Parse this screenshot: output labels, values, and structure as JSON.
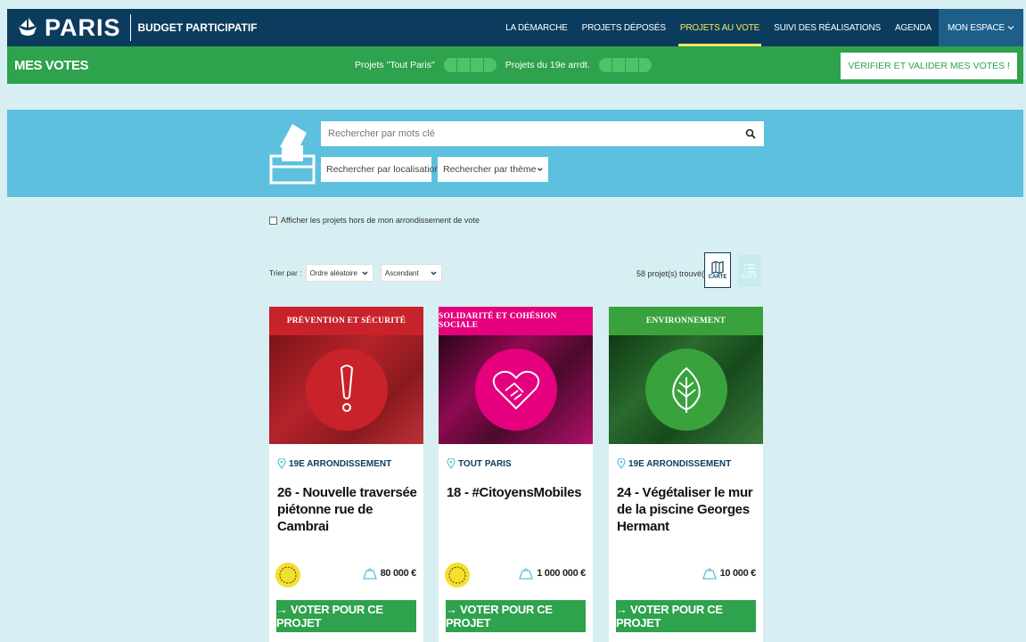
{
  "header": {
    "logo_text": "PARIS",
    "subtitle": "BUDGET PARTICIPATIF",
    "nav": [
      {
        "label": "LA DÉMARCHE"
      },
      {
        "label": "PROJETS DÉPOSÉS"
      },
      {
        "label": "PROJETS AU VOTE",
        "active": true
      },
      {
        "label": "SUIVI DES RÉALISATIONS"
      },
      {
        "label": "AGENDA"
      }
    ],
    "account_label": "MON ESPACE"
  },
  "votebar": {
    "title": "MES VOTES",
    "counter_paris": "Projets \"Tout Paris\"",
    "counter_arrdt": "Projets du 19e arrdt.",
    "validate_label": "VÉRIFIER ET VALIDER MES VOTES !"
  },
  "search": {
    "placeholder": "Rechercher par mots clé",
    "location_label": "Rechercher par localisation",
    "theme_label": "Rechercher par thème"
  },
  "filters": {
    "outside_label": "Afficher les projets hors de mon arrondissement de vote",
    "sort_label": "Trier par :",
    "sort_value": "Ordre aléatoire",
    "order_value": "Ascendant",
    "found": "58 projet(s) trouvé(s)",
    "view_map": "CARTE",
    "view_list": "LISTE"
  },
  "colors": {
    "navy": "#0b3c5d",
    "green": "#2ea24c",
    "cyan": "#5cc0de",
    "red": "#c8222a",
    "magenta": "#e5007e",
    "leaf_green": "#3aa23c"
  },
  "cards": [
    {
      "theme": "PRÉVENTION ET SÉCURITÉ",
      "icon": "exclamation-icon",
      "location": "19E ARRONDISSEMENT",
      "title": "26 - Nouvelle traversée piétonne rue de Cambrai",
      "budget": "80 000 €",
      "vote_label": "→ VOTER POUR CE PROJET"
    },
    {
      "theme": "SOLIDARITÉ ET COHÉSION SOCIALE",
      "icon": "heart-handshake-icon",
      "location": "TOUT PARIS",
      "title": "18 - #CitoyensMobiles",
      "budget": "1 000 000 €",
      "vote_label": "→ VOTER POUR CE PROJET"
    },
    {
      "theme": "ENVIRONNEMENT",
      "icon": "leaf-icon",
      "location": "19E ARRONDISSEMENT",
      "title": "24 - Végétaliser le mur de la piscine Georges Hermant",
      "budget": "10 000 €",
      "vote_label": "→ VOTER POUR CE PROJET"
    }
  ]
}
